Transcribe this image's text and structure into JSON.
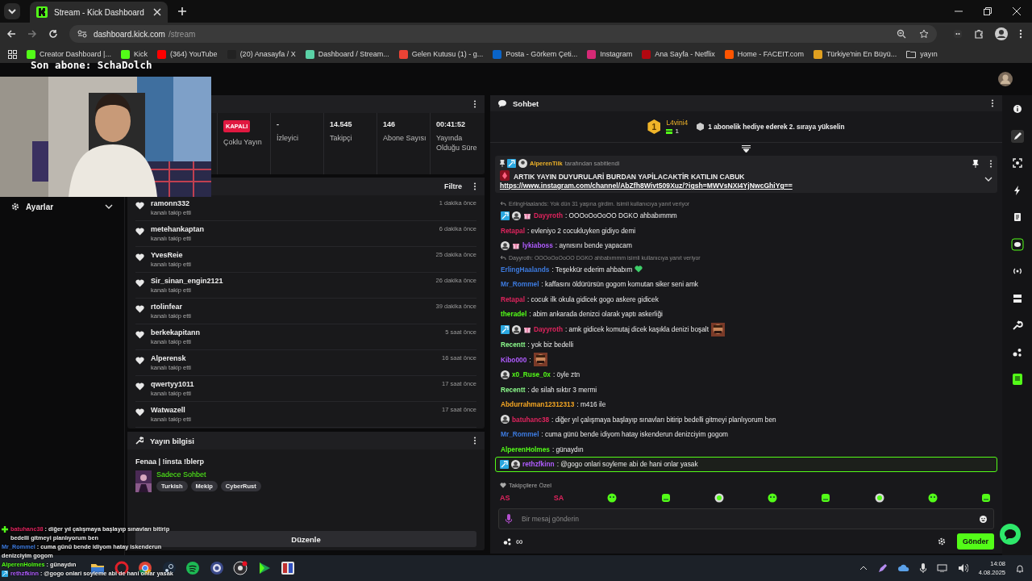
{
  "browser": {
    "tab": {
      "title": "Stream - Kick Dashboard"
    },
    "address": {
      "host": "dashboard.kick.com",
      "path": "/stream"
    },
    "bookmarks": [
      "Creator Dashboard |...",
      "Kick",
      "(364) YouTube",
      "(20) Anasayfa / X",
      "Dashboard / Stream...",
      "Gelen Kutusu (1) - g...",
      "Posta - Görkem Çeti...",
      "Instagram",
      "Ana Sayfa - Netflix",
      "Home - FACEIT.com",
      "Türkiye'nin En Büyü...",
      "yayın"
    ]
  },
  "overlay": {
    "last_sub": "Son abone: SchaDolch",
    "webcam": {
      "kind": "picture"
    },
    "chat": [
      {
        "badge": {
          "kind": "plus"
        },
        "user": "batuhanc38",
        "color": "#e0245e",
        "text": " : diğer yıl çalışmaya başlayıp sınavları bitirip bedelli gitmeyi planlıyorum ben"
      },
      {
        "user": "Mr_Rommel",
        "color": "#3d7be0",
        "text": " : cuma günü bende idiyom hatay iskenderun denizciyim gogom"
      },
      {
        "user": "AlperenHolmes",
        "color": "#53fc18",
        "text": " : günaydın"
      },
      {
        "badge": {
          "kind": "mod"
        },
        "user": "rethzfkinn",
        "color": "#b05cff",
        "text": " : @gogo onlari soyleme abi de hani onlar yasak"
      }
    ]
  },
  "sidebar": {
    "items": [
      {
        "label": "Ayarlar"
      }
    ]
  },
  "stats": {
    "multistream": {
      "badge": "KAPALI",
      "label": "Çoklu Yayın"
    },
    "items": [
      {
        "value": "-",
        "label": "İzleyici"
      },
      {
        "value": "14.545",
        "label": "Takipçi"
      },
      {
        "value": "146",
        "label": "Abone Sayısı"
      },
      {
        "value": "00:41:52",
        "label": "Yayında Olduğu Süre"
      }
    ]
  },
  "activity": {
    "filter": "Filtre",
    "items": [
      {
        "user": "ramonn332",
        "action": "kanalı takip etti",
        "time": "1 dakika önce"
      },
      {
        "user": "metehankaptan",
        "action": "kanalı takip etti",
        "time": "6 dakika önce"
      },
      {
        "user": "YvesReie",
        "action": "kanalı takip etti",
        "time": "25 dakika önce"
      },
      {
        "user": "Sir_sinan_engin2121",
        "action": "kanalı takip etti",
        "time": "26 dakika önce"
      },
      {
        "user": "rtolinfear",
        "action": "kanalı takip etti",
        "time": "39 dakika önce"
      },
      {
        "user": "berkekapitann",
        "action": "kanalı takip etti",
        "time": "5 saat önce"
      },
      {
        "user": "Alperensk",
        "action": "kanalı takip etti",
        "time": "16 saat önce"
      },
      {
        "user": "qwertyy1011",
        "action": "kanalı takip etti",
        "time": "17 saat önce"
      },
      {
        "user": "Watwazell",
        "action": "kanalı takip etti",
        "time": "17 saat önce"
      }
    ]
  },
  "stream_info": {
    "title": "Yayın bilgisi",
    "stream_title": "Fenaa | !insta !blerp",
    "category": "Sadece Sohbet",
    "tags": [
      "Turkish",
      "Mekip",
      "CyberRust"
    ],
    "edit_button": "Düzenle"
  },
  "chat": {
    "title": "Sohbet",
    "leader": {
      "rank": "1",
      "user": "L4vini4",
      "count": "1",
      "hint": "1 abonelik hediye ederek 2. sıraya yükselin"
    },
    "pinned": {
      "by": "AlperenTilk",
      "note": "tarafından sabitlendi",
      "text": "ARTIK YAYIN DUYURULARİ BURDAN YAPİLACAKTİR KATILIN CABUK",
      "link": "https://www.instagram.com/channel/AbZfh8Wivt509Xuz/?igsh=MWVsNXI4YjNwcGhiYg=="
    },
    "messages": [
      {
        "kind": "reply",
        "text": "ErlingHaalands: Yok dün 31 yaşına girdim. isimli kullanıcıya yanıt veriyor"
      },
      {
        "kind": "message",
        "badges": [
          {
            "kind": "mod"
          },
          {
            "kind": "avatar"
          },
          {
            "kind": "gift"
          }
        ],
        "user": "Dayyroth",
        "color": "#e0245e",
        "text": ": OOOoOoOoOO DGKO ahbabımmm",
        "highlighted": false
      },
      {
        "kind": "message",
        "user": "Retapal",
        "color": "#e0245e",
        "text": ": evleniyo 2 cocukluyken gidiyo demi",
        "highlighted": false
      },
      {
        "kind": "message",
        "badges": [
          {
            "kind": "avatar"
          },
          {
            "kind": "gift"
          }
        ],
        "user": "lykiaboss",
        "color": "#b05cff",
        "text": ": aynısını bende yapacam",
        "highlighted": false
      },
      {
        "kind": "reply",
        "text": "Dayyroth: OOOoOoOoOO DGKO ahbabımmm isimli kullanıcıya yanıt veriyor"
      },
      {
        "kind": "message",
        "user": "ErlingHaalands",
        "color": "#3d7be0",
        "text": ": Teşekkür ederim ahbabım",
        "emote": {
          "kind": "heart"
        },
        "highlighted": false
      },
      {
        "kind": "message",
        "user": "Mr_Rommel",
        "color": "#3d7be0",
        "text": ": kaffasını öldürürsün gogom komutan siker seni amk",
        "highlighted": false
      },
      {
        "kind": "message",
        "user": "Retapal",
        "color": "#e0245e",
        "text": ": cocuk ilk okula gidicek gogo askere gidicek",
        "highlighted": false
      },
      {
        "kind": "message",
        "user": "theradel",
        "color": "#53fc18",
        "text": ": abim ankarada denizci olarak yaptı askerliği",
        "highlighted": false
      },
      {
        "kind": "message",
        "badges": [
          {
            "kind": "mod"
          },
          {
            "kind": "avatar"
          },
          {
            "kind": "gift"
          }
        ],
        "user": "Dayyroth",
        "color": "#e0245e",
        "text": ": amk gidicek komutaj dicek kaşıkla denizi boşalt",
        "emote": {
          "kind": "picture"
        },
        "highlighted": false
      },
      {
        "kind": "message",
        "user": "Recentt",
        "color": "#8cfc8c",
        "text": ": yok biz bedelli",
        "highlighted": false
      },
      {
        "kind": "message",
        "user": "Kibo000",
        "color": "#b05cff",
        "text": ":",
        "emote": {
          "kind": "picture"
        },
        "highlighted": false
      },
      {
        "kind": "message",
        "badges": [
          {
            "kind": "avatar"
          }
        ],
        "user": "x0_Ruse_0x",
        "color": "#53fc18",
        "text": ": öyle ztn",
        "highlighted": false
      },
      {
        "kind": "message",
        "user": "Recentt",
        "color": "#8cfc8c",
        "text": ": de silah sıktır 3 mermi",
        "highlighted": false
      },
      {
        "kind": "message",
        "user": "Abdurrahman12312313",
        "color": "#f5a623",
        "text": ": m416 ile",
        "highlighted": false
      },
      {
        "kind": "message",
        "badges": [
          {
            "kind": "avatar"
          }
        ],
        "user": "batuhanc38",
        "color": "#e0245e",
        "text": ": diğer yıl çalışmaya başlayıp sınavları bitirip bedelli gitmeyi planlıyorum ben",
        "highlighted": false
      },
      {
        "kind": "message",
        "user": "Mr_Rommel",
        "color": "#3d7be0",
        "text": ": cuma günü bende idiyom hatay iskenderun denizciyim gogom",
        "highlighted": false
      },
      {
        "kind": "message",
        "user": "AlperenHolmes",
        "color": "#53fc18",
        "text": ": günaydın",
        "highlighted": false
      },
      {
        "kind": "message",
        "badges": [
          {
            "kind": "mod"
          },
          {
            "kind": "avatar"
          }
        ],
        "user": "rethzfkinn",
        "color": "#b05cff",
        "text": ": @gogo onlari soyleme abi de hani onlar yasak",
        "highlighted": true
      }
    ],
    "emote_section": "Takipçilere Özel",
    "text_emotes": [
      "AS",
      "SA"
    ],
    "input": {
      "placeholder": "Bir mesaj gönderin"
    },
    "points": "∞",
    "send_button": "Gönder"
  },
  "taskbar": {
    "time": "14:08",
    "date": "4.08.2025"
  }
}
